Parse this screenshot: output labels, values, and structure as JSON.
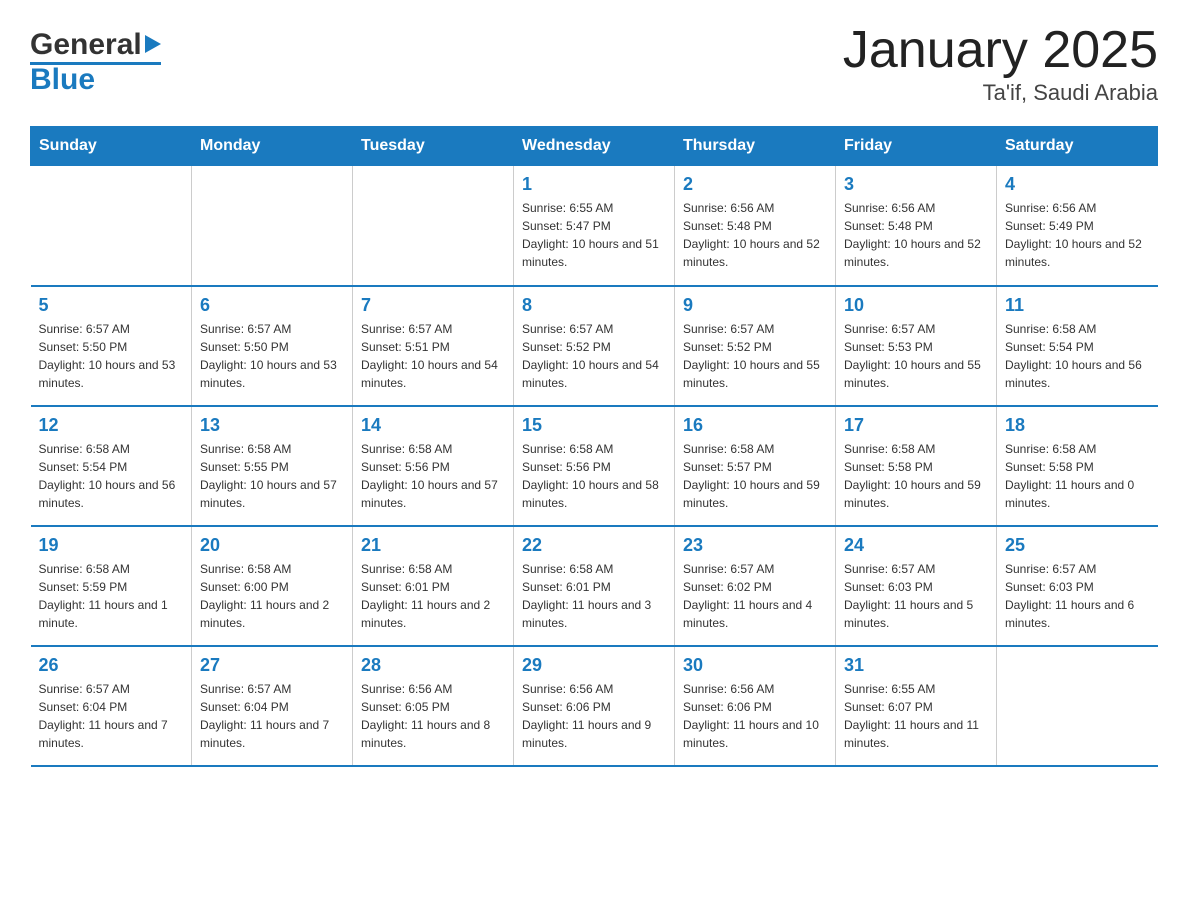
{
  "logo": {
    "general": "General",
    "blue": "Blue",
    "triangle_symbol": "▶"
  },
  "header": {
    "month_title": "January 2025",
    "location": "Ta'if, Saudi Arabia"
  },
  "days_of_week": [
    "Sunday",
    "Monday",
    "Tuesday",
    "Wednesday",
    "Thursday",
    "Friday",
    "Saturday"
  ],
  "weeks": [
    [
      {
        "day": "",
        "info": ""
      },
      {
        "day": "",
        "info": ""
      },
      {
        "day": "",
        "info": ""
      },
      {
        "day": "1",
        "info": "Sunrise: 6:55 AM\nSunset: 5:47 PM\nDaylight: 10 hours and 51 minutes."
      },
      {
        "day": "2",
        "info": "Sunrise: 6:56 AM\nSunset: 5:48 PM\nDaylight: 10 hours and 52 minutes."
      },
      {
        "day": "3",
        "info": "Sunrise: 6:56 AM\nSunset: 5:48 PM\nDaylight: 10 hours and 52 minutes."
      },
      {
        "day": "4",
        "info": "Sunrise: 6:56 AM\nSunset: 5:49 PM\nDaylight: 10 hours and 52 minutes."
      }
    ],
    [
      {
        "day": "5",
        "info": "Sunrise: 6:57 AM\nSunset: 5:50 PM\nDaylight: 10 hours and 53 minutes."
      },
      {
        "day": "6",
        "info": "Sunrise: 6:57 AM\nSunset: 5:50 PM\nDaylight: 10 hours and 53 minutes."
      },
      {
        "day": "7",
        "info": "Sunrise: 6:57 AM\nSunset: 5:51 PM\nDaylight: 10 hours and 54 minutes."
      },
      {
        "day": "8",
        "info": "Sunrise: 6:57 AM\nSunset: 5:52 PM\nDaylight: 10 hours and 54 minutes."
      },
      {
        "day": "9",
        "info": "Sunrise: 6:57 AM\nSunset: 5:52 PM\nDaylight: 10 hours and 55 minutes."
      },
      {
        "day": "10",
        "info": "Sunrise: 6:57 AM\nSunset: 5:53 PM\nDaylight: 10 hours and 55 minutes."
      },
      {
        "day": "11",
        "info": "Sunrise: 6:58 AM\nSunset: 5:54 PM\nDaylight: 10 hours and 56 minutes."
      }
    ],
    [
      {
        "day": "12",
        "info": "Sunrise: 6:58 AM\nSunset: 5:54 PM\nDaylight: 10 hours and 56 minutes."
      },
      {
        "day": "13",
        "info": "Sunrise: 6:58 AM\nSunset: 5:55 PM\nDaylight: 10 hours and 57 minutes."
      },
      {
        "day": "14",
        "info": "Sunrise: 6:58 AM\nSunset: 5:56 PM\nDaylight: 10 hours and 57 minutes."
      },
      {
        "day": "15",
        "info": "Sunrise: 6:58 AM\nSunset: 5:56 PM\nDaylight: 10 hours and 58 minutes."
      },
      {
        "day": "16",
        "info": "Sunrise: 6:58 AM\nSunset: 5:57 PM\nDaylight: 10 hours and 59 minutes."
      },
      {
        "day": "17",
        "info": "Sunrise: 6:58 AM\nSunset: 5:58 PM\nDaylight: 10 hours and 59 minutes."
      },
      {
        "day": "18",
        "info": "Sunrise: 6:58 AM\nSunset: 5:58 PM\nDaylight: 11 hours and 0 minutes."
      }
    ],
    [
      {
        "day": "19",
        "info": "Sunrise: 6:58 AM\nSunset: 5:59 PM\nDaylight: 11 hours and 1 minute."
      },
      {
        "day": "20",
        "info": "Sunrise: 6:58 AM\nSunset: 6:00 PM\nDaylight: 11 hours and 2 minutes."
      },
      {
        "day": "21",
        "info": "Sunrise: 6:58 AM\nSunset: 6:01 PM\nDaylight: 11 hours and 2 minutes."
      },
      {
        "day": "22",
        "info": "Sunrise: 6:58 AM\nSunset: 6:01 PM\nDaylight: 11 hours and 3 minutes."
      },
      {
        "day": "23",
        "info": "Sunrise: 6:57 AM\nSunset: 6:02 PM\nDaylight: 11 hours and 4 minutes."
      },
      {
        "day": "24",
        "info": "Sunrise: 6:57 AM\nSunset: 6:03 PM\nDaylight: 11 hours and 5 minutes."
      },
      {
        "day": "25",
        "info": "Sunrise: 6:57 AM\nSunset: 6:03 PM\nDaylight: 11 hours and 6 minutes."
      }
    ],
    [
      {
        "day": "26",
        "info": "Sunrise: 6:57 AM\nSunset: 6:04 PM\nDaylight: 11 hours and 7 minutes."
      },
      {
        "day": "27",
        "info": "Sunrise: 6:57 AM\nSunset: 6:04 PM\nDaylight: 11 hours and 7 minutes."
      },
      {
        "day": "28",
        "info": "Sunrise: 6:56 AM\nSunset: 6:05 PM\nDaylight: 11 hours and 8 minutes."
      },
      {
        "day": "29",
        "info": "Sunrise: 6:56 AM\nSunset: 6:06 PM\nDaylight: 11 hours and 9 minutes."
      },
      {
        "day": "30",
        "info": "Sunrise: 6:56 AM\nSunset: 6:06 PM\nDaylight: 11 hours and 10 minutes."
      },
      {
        "day": "31",
        "info": "Sunrise: 6:55 AM\nSunset: 6:07 PM\nDaylight: 11 hours and 11 minutes."
      },
      {
        "day": "",
        "info": ""
      }
    ]
  ]
}
